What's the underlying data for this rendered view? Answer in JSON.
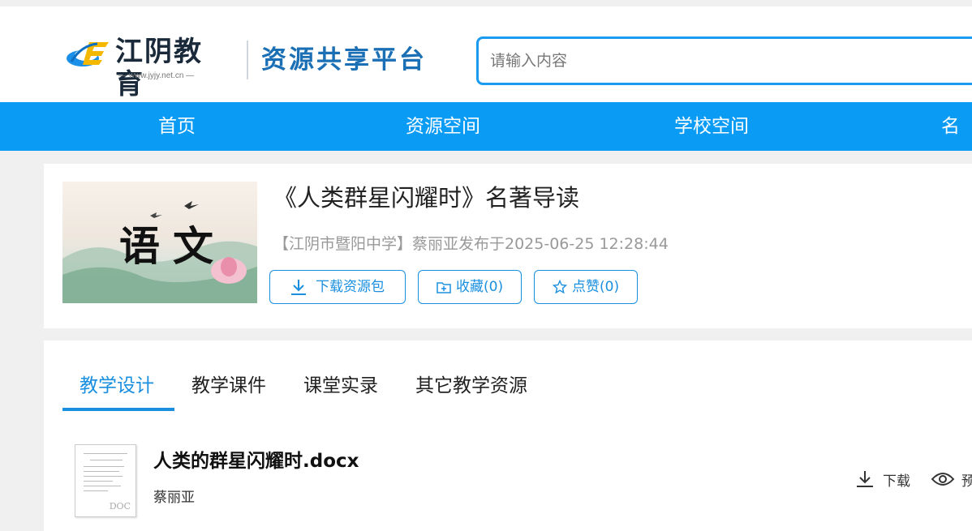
{
  "header": {
    "logo_text": "江阴教育",
    "logo_url": "— www.jyjy.net.cn —",
    "platform_title": "资源共享平台",
    "search_placeholder": "请输入内容"
  },
  "nav": {
    "items": [
      "首页",
      "资源空间",
      "学校空间",
      "名师"
    ]
  },
  "resource": {
    "cover_text": "语文",
    "title": "《人类群星闪耀时》名著导读",
    "meta": "【江阴市暨阳中学】蔡丽亚发布于2025-06-25 12:28:44",
    "buttons": {
      "download": "下载资源包",
      "favorite": "收藏(0)",
      "like": "点赞(0)"
    },
    "icons": {
      "download": "download-icon",
      "favorite": "folder-plus-icon",
      "like": "star-icon"
    }
  },
  "tabs": [
    "教学设计",
    "教学课件",
    "课堂实录",
    "其它教学资源"
  ],
  "active_tab": "教学设计",
  "files": [
    {
      "name": "人类的群星闪耀时.docx",
      "author": "蔡丽亚",
      "thumb_label": "DOC",
      "actions": {
        "download": "下载",
        "preview": "预"
      }
    }
  ],
  "colors": {
    "nav_bg": "#0a9bf5",
    "accent": "#1a8fe0",
    "platform_title": "#1a6fb5"
  }
}
